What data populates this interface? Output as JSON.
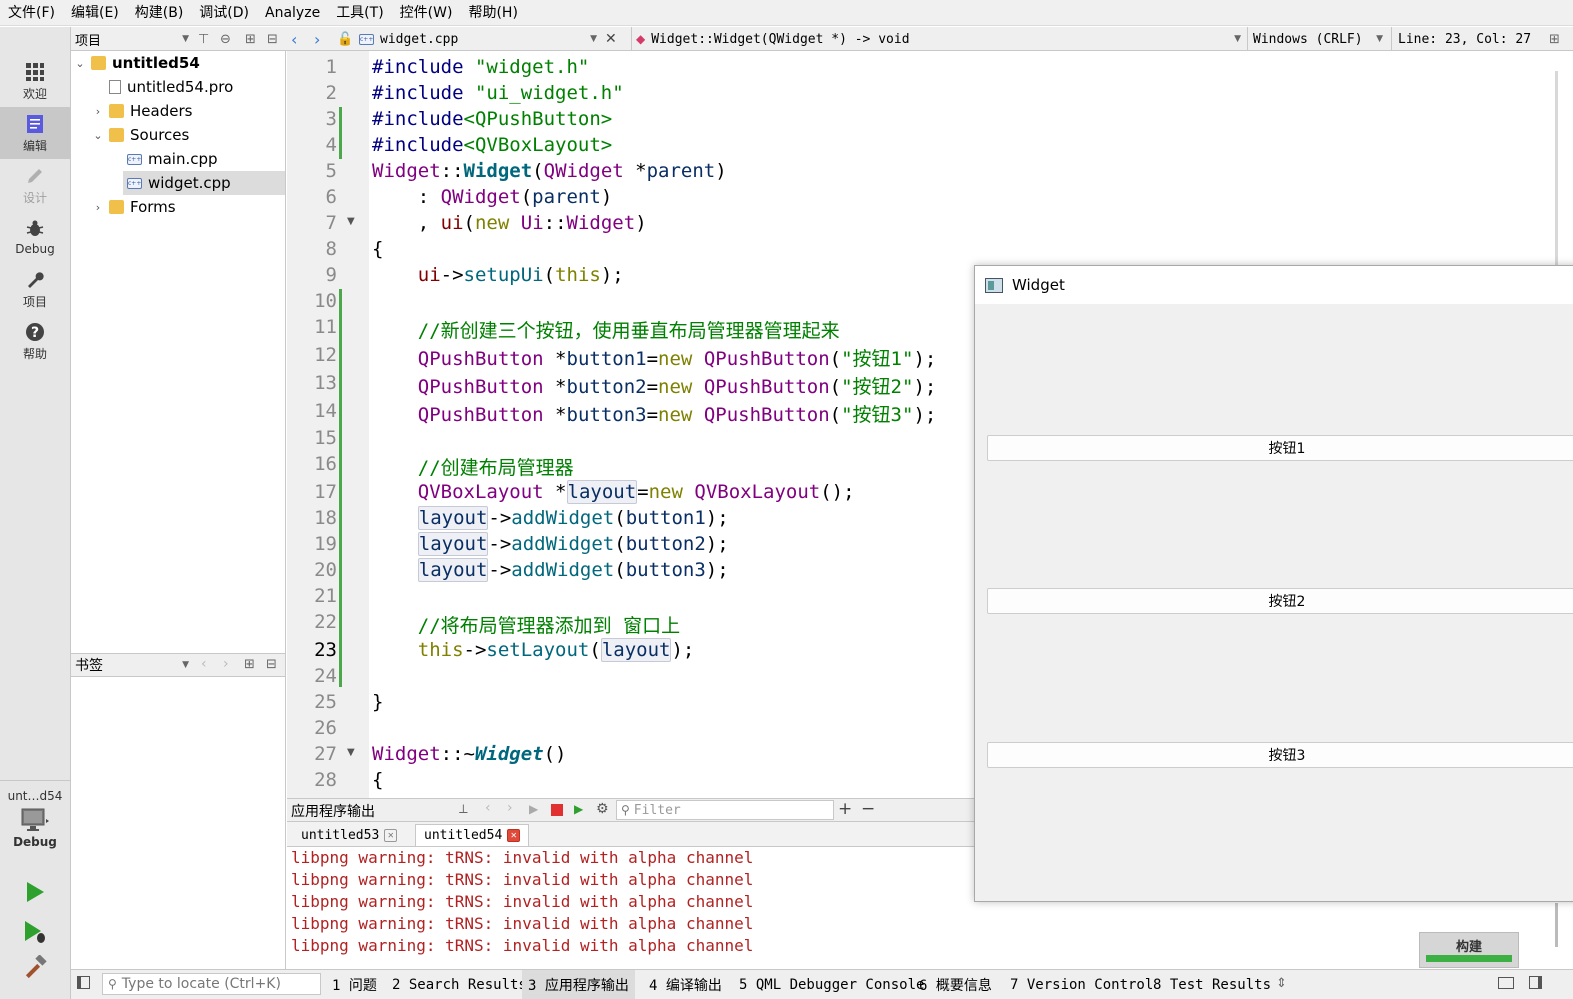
{
  "menubar": {
    "items": [
      "文件(F)",
      "编辑(E)",
      "构建(B)",
      "调试(D)",
      "Analyze",
      "工具(T)",
      "控件(W)",
      "帮助(H)"
    ]
  },
  "modebar": {
    "items": [
      {
        "label": "欢迎",
        "icon": "grid-icon"
      },
      {
        "label": "编辑",
        "icon": "edit-doc-icon"
      },
      {
        "label": "设计",
        "icon": "pencil-icon"
      },
      {
        "label": "Debug",
        "icon": "bug-icon"
      },
      {
        "label": "项目",
        "icon": "wrench-icon"
      },
      {
        "label": "帮助",
        "icon": "help-icon"
      }
    ],
    "kit_name": "unt…d54",
    "kit_mode": "Debug"
  },
  "project_pane": {
    "title": "项目",
    "tree": {
      "root": "untitled54",
      "pro_file": "untitled54.pro",
      "headers": "Headers",
      "sources": "Sources",
      "main_cpp": "main.cpp",
      "widget_cpp": "widget.cpp",
      "forms": "Forms"
    }
  },
  "bookmarks": {
    "title": "书签"
  },
  "editor_toolbar": {
    "file_name": "widget.cpp",
    "symbol": "Widget::Widget(QWidget *) -> void",
    "line_ending": "Windows (CRLF)",
    "cursor_pos": "Line: 23, Col: 27"
  },
  "editor": {
    "current_line": 23,
    "line_numbers": [
      "1",
      "2",
      "3",
      "4",
      "5",
      "6",
      "7",
      "8",
      "9",
      "10",
      "11",
      "12",
      "13",
      "14",
      "15",
      "16",
      "17",
      "18",
      "19",
      "20",
      "21",
      "22",
      "23",
      "24",
      "25",
      "26",
      "27",
      "28"
    ],
    "code": {
      "l1a": "#include ",
      "l1b": "\"widget.h\"",
      "l2a": "#include ",
      "l2b": "\"ui_widget.h\"",
      "l3a": "#include",
      "l3b": "<QPushButton>",
      "l4a": "#include",
      "l4b": "<QVBoxLayout>",
      "l5a": "Widget",
      "l5b": "::",
      "l5c": "Widget",
      "l5d": "(",
      "l5e": "QWidget",
      "l5f": " *",
      "l5g": "parent",
      "l5h": ")",
      "l6a": "    : ",
      "l6b": "QWidget",
      "l6c": "(",
      "l6d": "parent",
      "l6e": ")",
      "l7a": "    , ",
      "l7b": "ui",
      "l7c": "(",
      "l7d": "new",
      "l7e": " ",
      "l7f": "Ui",
      "l7g": "::",
      "l7h": "Widget",
      "l7i": ")",
      "l8": "{",
      "l9a": "    ",
      "l9b": "ui",
      "l9c": "->",
      "l9d": "setupUi",
      "l9e": "(",
      "l9f": "this",
      "l9g": ");",
      "l11": "    //新创建三个按钮，使用垂直布局管理器管理起来",
      "l12a": "    ",
      "l12b": "QPushButton",
      "l12c": " *",
      "l12d": "button1",
      "l12e": "=",
      "l12f": "new",
      "l12g": " ",
      "l12h": "QPushButton",
      "l12i": "(",
      "l12j": "\"按钮1\"",
      "l12k": ");",
      "l13a": "    ",
      "l13b": "QPushButton",
      "l13c": " *",
      "l13d": "button2",
      "l13e": "=",
      "l13f": "new",
      "l13g": " ",
      "l13h": "QPushButton",
      "l13i": "(",
      "l13j": "\"按钮2\"",
      "l13k": ");",
      "l14a": "    ",
      "l14b": "QPushButton",
      "l14c": " *",
      "l14d": "button3",
      "l14e": "=",
      "l14f": "new",
      "l14g": " ",
      "l14h": "QPushButton",
      "l14i": "(",
      "l14j": "\"按钮3\"",
      "l14k": ");",
      "l16": "    //创建布局管理器",
      "l17a": "    ",
      "l17b": "QVBoxLayout",
      "l17c": " *",
      "l17d": "layout",
      "l17e": "=",
      "l17f": "new",
      "l17g": " ",
      "l17h": "QVBoxLayout",
      "l17i": "();",
      "l18a": "    ",
      "l18b": "layout",
      "l18c": "->",
      "l18d": "addWidget",
      "l18e": "(",
      "l18f": "button1",
      "l18g": ");",
      "l19a": "    ",
      "l19b": "layout",
      "l19c": "->",
      "l19d": "addWidget",
      "l19e": "(",
      "l19f": "button2",
      "l19g": ");",
      "l20a": "    ",
      "l20b": "layout",
      "l20c": "->",
      "l20d": "addWidget",
      "l20e": "(",
      "l20f": "button3",
      "l20g": ");",
      "l22": "    //将布局管理器添加到 窗口上",
      "l23a": "    ",
      "l23b": "this",
      "l23c": "->",
      "l23d": "setLayout",
      "l23e": "(",
      "l23f": "layout",
      "l23g": ");",
      "l25": "}",
      "l27a": "Widget",
      "l27b": "::~",
      "l27c": "Widget",
      "l27d": "()",
      "l28": "{"
    }
  },
  "output_pane": {
    "title": "应用程序输出",
    "filter_placeholder": "Filter",
    "tabs": [
      "untitled53",
      "untitled54"
    ],
    "lines": [
      "libpng warning: tRNS: invalid with alpha channel",
      "libpng warning: tRNS: invalid with alpha channel",
      "libpng warning: tRNS: invalid with alpha channel",
      "libpng warning: tRNS: invalid with alpha channel",
      "libpng warning: tRNS: invalid with alpha channel"
    ]
  },
  "build_progress": {
    "label": "构建",
    "progress": 1.0,
    "color": "#3cb043"
  },
  "statusbar": {
    "locate_placeholder": "Type to locate (Ctrl+K)",
    "tabs": [
      "1 问题",
      "2 Search Results",
      "3 应用程序输出",
      "4 编译输出",
      "5 QML Debugger Console",
      "6 概要信息",
      "7 Version Control",
      "8 Test Results"
    ]
  },
  "widget_window": {
    "title": "Widget",
    "buttons": [
      "按钮1",
      "按钮2",
      "按钮3"
    ]
  },
  "colors": {
    "run": "#2ea02e",
    "stop": "#e03030",
    "output_error": "#b22222",
    "change_marker": "#4aa84a"
  }
}
